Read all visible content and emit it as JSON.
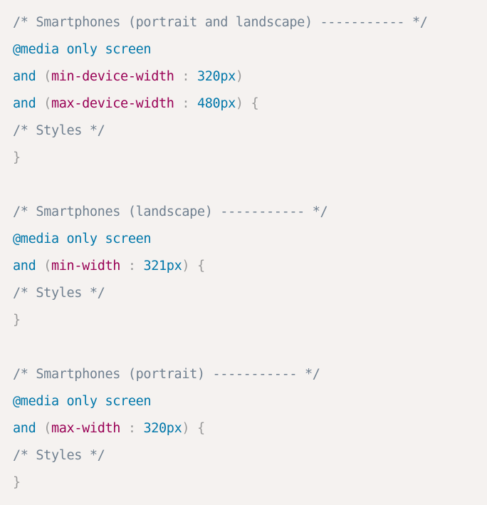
{
  "code": {
    "lines": [
      [
        {
          "t": "/* Smartphones (portrait and landscape) ----------- */",
          "c": "comment"
        }
      ],
      [
        {
          "t": "@media",
          "c": "atrule"
        },
        {
          "t": " only screen",
          "c": "keyword"
        }
      ],
      [
        {
          "t": "and",
          "c": "keyword"
        },
        {
          "t": " ",
          "c": "plain"
        },
        {
          "t": "(",
          "c": "punct"
        },
        {
          "t": "min-device-width",
          "c": "property"
        },
        {
          "t": " : ",
          "c": "punct"
        },
        {
          "t": "320px",
          "c": "number"
        },
        {
          "t": ")",
          "c": "punct"
        }
      ],
      [
        {
          "t": "and",
          "c": "keyword"
        },
        {
          "t": " ",
          "c": "plain"
        },
        {
          "t": "(",
          "c": "punct"
        },
        {
          "t": "max-device-width",
          "c": "property"
        },
        {
          "t": " : ",
          "c": "punct"
        },
        {
          "t": "480px",
          "c": "number"
        },
        {
          "t": ")",
          "c": "punct"
        },
        {
          "t": " {",
          "c": "punct"
        }
      ],
      [
        {
          "t": "/* Styles */",
          "c": "comment"
        }
      ],
      [
        {
          "t": "}",
          "c": "punct"
        }
      ],
      [],
      [
        {
          "t": "/* Smartphones (landscape) ----------- */",
          "c": "comment"
        }
      ],
      [
        {
          "t": "@media",
          "c": "atrule"
        },
        {
          "t": " only screen",
          "c": "keyword"
        }
      ],
      [
        {
          "t": "and",
          "c": "keyword"
        },
        {
          "t": " ",
          "c": "plain"
        },
        {
          "t": "(",
          "c": "punct"
        },
        {
          "t": "min-width",
          "c": "property"
        },
        {
          "t": " : ",
          "c": "punct"
        },
        {
          "t": "321px",
          "c": "number"
        },
        {
          "t": ")",
          "c": "punct"
        },
        {
          "t": " {",
          "c": "punct"
        }
      ],
      [
        {
          "t": "/* Styles */",
          "c": "comment"
        }
      ],
      [
        {
          "t": "}",
          "c": "punct"
        }
      ],
      [],
      [
        {
          "t": "/* Smartphones (portrait) ----------- */",
          "c": "comment"
        }
      ],
      [
        {
          "t": "@media",
          "c": "atrule"
        },
        {
          "t": " only screen",
          "c": "keyword"
        }
      ],
      [
        {
          "t": "and",
          "c": "keyword"
        },
        {
          "t": " ",
          "c": "plain"
        },
        {
          "t": "(",
          "c": "punct"
        },
        {
          "t": "max-width",
          "c": "property"
        },
        {
          "t": " : ",
          "c": "punct"
        },
        {
          "t": "320px",
          "c": "number"
        },
        {
          "t": ")",
          "c": "punct"
        },
        {
          "t": " {",
          "c": "punct"
        }
      ],
      [
        {
          "t": "/* Styles */",
          "c": "comment"
        }
      ],
      [
        {
          "t": "}",
          "c": "punct"
        }
      ]
    ]
  },
  "colors": {
    "background": "#f5f2f0",
    "comment": "#708090",
    "keyword": "#0077aa",
    "property": "#990055",
    "punctuation": "#999999",
    "number": "#0077aa"
  }
}
